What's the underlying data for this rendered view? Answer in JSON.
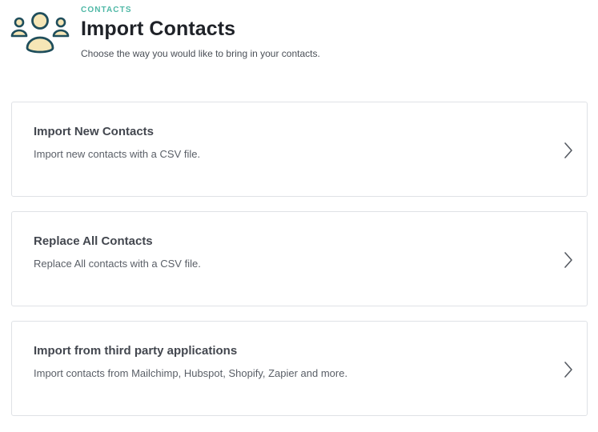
{
  "header": {
    "eyebrow": "CONTACTS",
    "title": "Import Contacts",
    "subtitle": "Choose the way you would like to bring in your contacts.",
    "icon": "contacts-group-icon"
  },
  "options": [
    {
      "title": "Import New Contacts",
      "description": "Import new contacts with a CSV file.",
      "icon": "chevron-right-icon"
    },
    {
      "title": "Replace All Contacts",
      "description": "Replace All contacts with a CSV file.",
      "icon": "chevron-right-icon"
    },
    {
      "title": "Import from third party applications",
      "description": "Import contacts from Mailchimp, Hubspot, Shopify, Zapier and more.",
      "icon": "chevron-right-icon"
    }
  ],
  "colors": {
    "accent": "#4fb8a6",
    "icon_stroke": "#1f4e5c",
    "icon_fill": "#f6e6b6",
    "border": "#dfe2e6"
  }
}
